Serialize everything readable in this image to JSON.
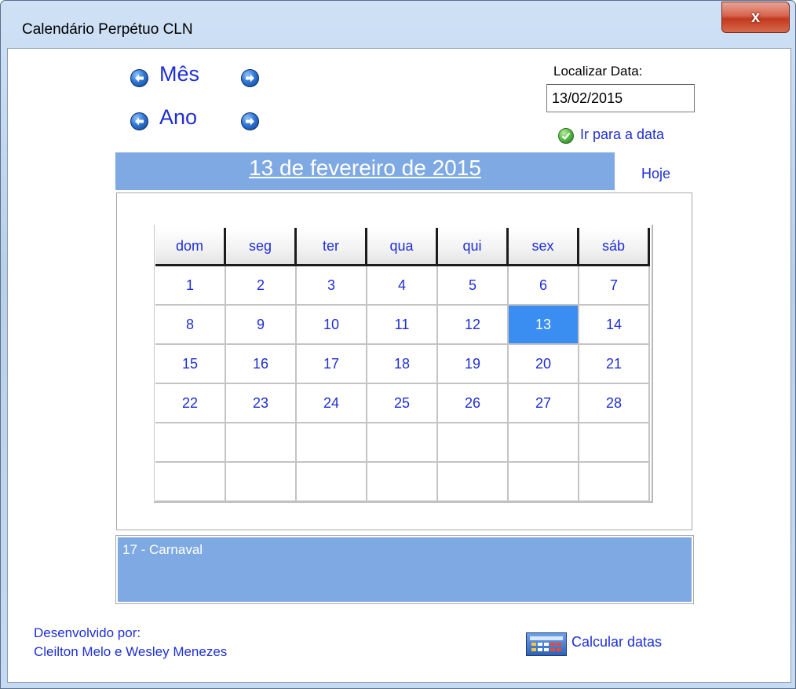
{
  "window": {
    "title": "Calendário Perpétuo CLN",
    "close_label": "x"
  },
  "nav": {
    "month_label": "Mês",
    "year_label": "Ano"
  },
  "search": {
    "label": "Localizar Data:",
    "value": "13/02/2015",
    "goto_label": "Ir para a data"
  },
  "current_date": {
    "text": "13 de fevereiro de 2015",
    "today_label": "Hoje"
  },
  "calendar": {
    "weekdays": [
      "dom",
      "seg",
      "ter",
      "qua",
      "qui",
      "sex",
      "sáb"
    ],
    "weeks": [
      [
        "1",
        "2",
        "3",
        "4",
        "5",
        "6",
        "7"
      ],
      [
        "8",
        "9",
        "10",
        "11",
        "12",
        "13",
        "14"
      ],
      [
        "15",
        "16",
        "17",
        "18",
        "19",
        "20",
        "21"
      ],
      [
        "22",
        "23",
        "24",
        "25",
        "26",
        "27",
        "28"
      ],
      [
        "",
        "",
        "",
        "",
        "",
        "",
        ""
      ],
      [
        "",
        "",
        "",
        "",
        "",
        "",
        ""
      ]
    ],
    "selected_day": "13"
  },
  "holidays": {
    "text": "17 - Carnaval"
  },
  "footer": {
    "developed_by_label": "Desenvolvido por:",
    "developers": "Cleilton Melo e Wesley Menezes",
    "calc_label": "Calcular datas"
  },
  "colors": {
    "accent": "#7fa9e3",
    "selected": "#3a8ef2",
    "link": "#1e2fd6"
  },
  "icons": [
    "arrow-left-icon",
    "arrow-right-icon",
    "check-circle-icon",
    "calculator-icon",
    "close-icon"
  ]
}
